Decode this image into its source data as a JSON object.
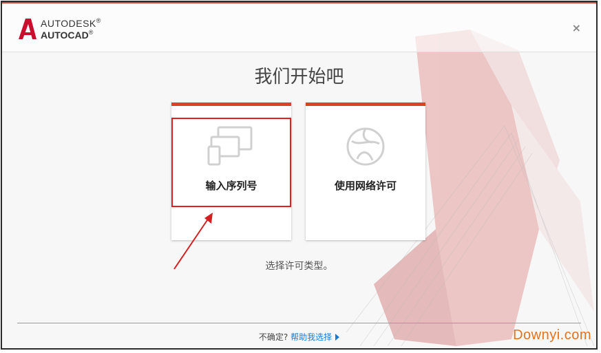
{
  "header": {
    "brand_line1": "AUTODESK",
    "brand_line2": "AUTOCAD",
    "registered_mark": "®",
    "close_symbol": "×",
    "logo_icon": "autocad-a-logo-icon",
    "close_icon": "close-icon"
  },
  "main": {
    "title": "我们开始吧",
    "options": [
      {
        "label": "输入序列号",
        "icon": "devices-icon",
        "selected": true
      },
      {
        "label": "使用网络许可",
        "icon": "globe-icon",
        "selected": false
      }
    ],
    "hint": "选择许可类型。"
  },
  "footer": {
    "question": "不确定?",
    "help_link": "帮助我选择",
    "arrow_icon": "play-arrow-icon"
  },
  "watermark": "Downyi.com",
  "colors": {
    "accent_bar": "#d9431e",
    "highlight_box": "#e02020",
    "link": "#1a7bd6",
    "watermark": "#e2731e"
  }
}
